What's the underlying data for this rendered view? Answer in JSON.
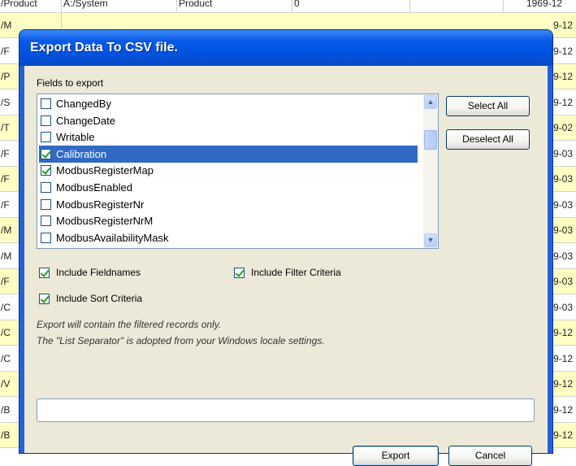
{
  "background_table": {
    "first_row": [
      "/Product",
      "A:/System",
      "Product",
      "0",
      "",
      "1969-12"
    ],
    "left_fragments": [
      "/M",
      "/F",
      "/P",
      "/S",
      "/T",
      "/F",
      "/F",
      "/F",
      "/M",
      "/M",
      "/F",
      "/C",
      "/C",
      "/C",
      "/V",
      "/B",
      "/B"
    ],
    "right_fragments": [
      "9-12",
      "9-12",
      "9-12",
      "9-12",
      "9-02",
      "9-03",
      "9-03",
      "9-03",
      "9-03",
      "9-03",
      "9-03",
      "9-03",
      "9-12",
      "9-12",
      "9-12",
      "9-12",
      "9-12"
    ]
  },
  "dialog": {
    "title": "Export Data To CSV file.",
    "fields_label": "Fields to export",
    "fields": [
      {
        "label": "ChangedBy",
        "checked": false,
        "selected": false
      },
      {
        "label": "ChangeDate",
        "checked": false,
        "selected": false
      },
      {
        "label": "Writable",
        "checked": false,
        "selected": false
      },
      {
        "label": "Calibration",
        "checked": true,
        "selected": true
      },
      {
        "label": "ModbusRegisterMap",
        "checked": true,
        "selected": false
      },
      {
        "label": "ModbusEnabled",
        "checked": false,
        "selected": false
      },
      {
        "label": "ModbusRegisterNr",
        "checked": false,
        "selected": false
      },
      {
        "label": "ModbusRegisterNrM",
        "checked": false,
        "selected": false
      },
      {
        "label": "ModbusAvailabilityMask",
        "checked": false,
        "selected": false
      }
    ],
    "select_all_label": "Select All",
    "deselect_all_label": "Deselect All",
    "include_fieldnames_label": "Include Fieldnames",
    "include_fieldnames_checked": true,
    "include_filter_label": "Include Filter Criteria",
    "include_filter_checked": true,
    "include_sort_label": "Include Sort Criteria",
    "include_sort_checked": true,
    "note_line1": "Export will contain the filtered records only.",
    "note_line2": "The \"List Separator\" is adopted from your Windows locale settings.",
    "file_path_value": "",
    "export_label": "Export",
    "cancel_label": "Cancel",
    "scroll_up_icon": "chevron-up-icon",
    "scroll_down_icon": "chevron-down-icon"
  }
}
